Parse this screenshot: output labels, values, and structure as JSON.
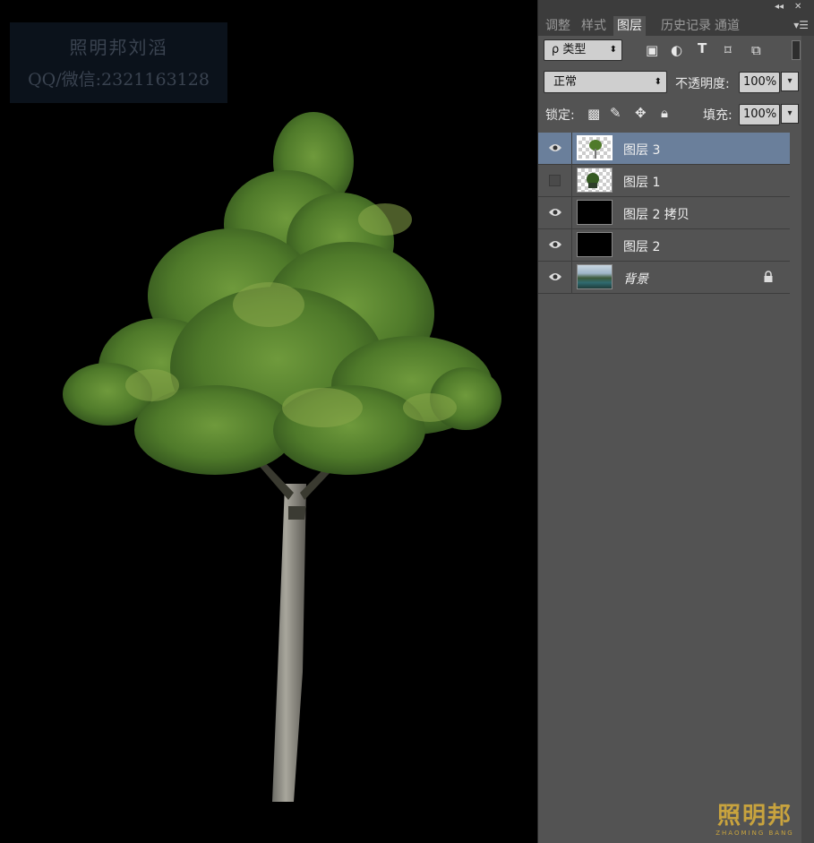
{
  "canvas": {
    "watermark": {
      "line1": "照明邦刘滔",
      "line2": "QQ/微信:2321163128"
    }
  },
  "panel": {
    "tabs": [
      {
        "label": "调整",
        "active": false
      },
      {
        "label": "样式",
        "active": false
      },
      {
        "label": "图层",
        "active": true
      },
      {
        "label": "历史记录",
        "active": false
      },
      {
        "label": "通道",
        "active": false
      }
    ],
    "filter": {
      "label": "ρ 类型"
    },
    "blend_mode": {
      "value": "正常"
    },
    "opacity": {
      "label": "不透明度:",
      "value": "100%"
    },
    "lock": {
      "label": "锁定:"
    },
    "fill": {
      "label": "填充:",
      "value": "100%"
    },
    "layers": [
      {
        "name": "图层 3",
        "visible": true,
        "selected": true,
        "thumb": "checker-tree",
        "locked": false
      },
      {
        "name": "图层 1",
        "visible": false,
        "selected": false,
        "thumb": "checker-tree",
        "locked": false
      },
      {
        "name": "图层 2 拷贝",
        "visible": true,
        "selected": false,
        "thumb": "black",
        "locked": false
      },
      {
        "name": "图层 2",
        "visible": true,
        "selected": false,
        "thumb": "black",
        "locked": false
      },
      {
        "name": "背景",
        "visible": true,
        "selected": false,
        "thumb": "photo",
        "locked": true
      }
    ],
    "brand": {
      "cn": "照明邦",
      "en": "ZHAOMING BANG"
    }
  },
  "colors": {
    "panel_bg": "#535353",
    "selected_layer": "#6a7f9b",
    "brand_gold": "#c8a33e"
  }
}
